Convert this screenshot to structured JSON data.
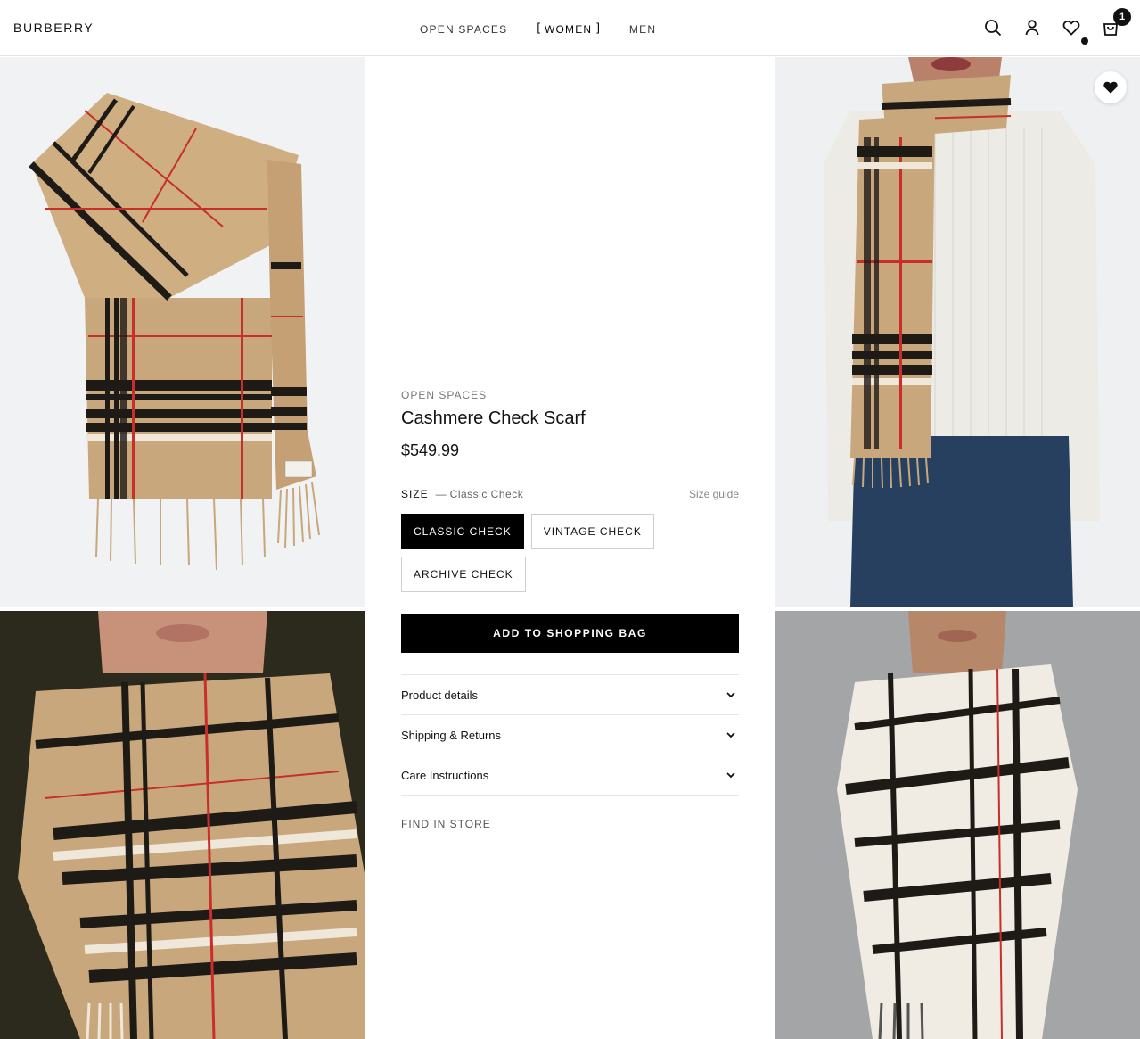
{
  "header": {
    "logo": "BURBERRY",
    "nav": [
      {
        "label": "OPEN SPACES"
      },
      {
        "label": "WOMEN"
      },
      {
        "label": "MEN"
      }
    ],
    "bracket_open": "[",
    "bracket_close": "]",
    "cart_count": "1"
  },
  "product": {
    "brand": "OPEN SPACES",
    "title": "Cashmere Check Scarf",
    "price": "$549.99",
    "size_label": "SIZE",
    "size_dash": "—",
    "size_selected": "Classic Check",
    "size_guide": "Size guide",
    "options": [
      {
        "label": "CLASSIC CHECK"
      },
      {
        "label": "VINTAGE CHECK"
      },
      {
        "label": "ARCHIVE CHECK"
      }
    ],
    "add_to_bag": "ADD TO SHOPPING BAG",
    "accordion": [
      {
        "label": "Product details"
      },
      {
        "label": "Shipping & Returns"
      },
      {
        "label": "Care Instructions"
      }
    ],
    "find_in_store": "FIND IN STORE"
  },
  "colors": {
    "camel": "#c9a77c",
    "black": "#111111",
    "red": "#c62f2a",
    "cream": "#efe7da",
    "selected_option": "#000000"
  },
  "icons": [
    "search-icon",
    "account-icon",
    "heart-icon",
    "bag-icon",
    "chevron-down-icon"
  ]
}
